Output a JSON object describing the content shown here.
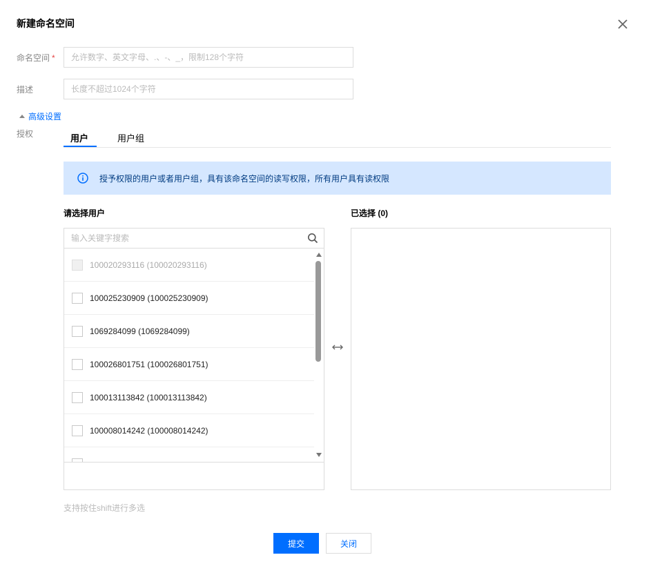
{
  "dialog": {
    "title": "新建命名空间",
    "close_icon": "close-icon"
  },
  "form": {
    "namespace_label": "命名空间",
    "namespace_required": "*",
    "namespace_placeholder": "允许数字、英文字母、.、-、_，限制128个字符",
    "description_label": "描述",
    "description_placeholder": "长度不超过1024个字符",
    "advanced_toggle": "高级设置",
    "auth_label": "授权"
  },
  "tabs": [
    {
      "label": "用户",
      "active": true
    },
    {
      "label": "用户组",
      "active": false
    }
  ],
  "info_banner": {
    "icon": "info-icon",
    "text": "授予权限的用户或者用户组，具有该命名空间的读写权限，所有用户具有读权限"
  },
  "selector": {
    "left_title": "请选择用户",
    "right_title": "已选择 (0)",
    "search_placeholder": "输入关键字搜索",
    "items": [
      {
        "label": "100020293116 (100020293116)",
        "disabled": true
      },
      {
        "label": "100025230909 (100025230909)",
        "disabled": false
      },
      {
        "label": "1069284099 (1069284099)",
        "disabled": false
      },
      {
        "label": "100026801751 (100026801751)",
        "disabled": false
      },
      {
        "label": "100013113842 (100013113842)",
        "disabled": false
      },
      {
        "label": "100008014242 (100008014242)",
        "disabled": false
      }
    ],
    "hint": "支持按住shift进行多选"
  },
  "footer": {
    "submit_label": "提交",
    "close_label": "关闭"
  },
  "colors": {
    "primary": "#006eff",
    "banner_bg": "#d5e7ff",
    "required": "#e54545"
  }
}
